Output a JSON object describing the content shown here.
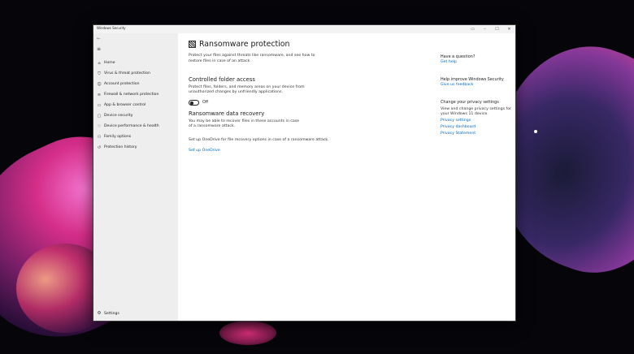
{
  "window": {
    "title": "Windows Security",
    "controls": {
      "restore": "▭",
      "minimize": "–",
      "maximize": "☐",
      "close": "✕"
    }
  },
  "sidebar": {
    "back": "←",
    "menu": "≡",
    "items": [
      {
        "label": "Home",
        "icon": "home-icon",
        "glyph": "⌂"
      },
      {
        "label": "Virus & threat protection",
        "icon": "shield-icon",
        "glyph": "⛉"
      },
      {
        "label": "Account protection",
        "icon": "person-icon",
        "glyph": "☺"
      },
      {
        "label": "Firewall & network protection",
        "icon": "wifi-icon",
        "glyph": "≋"
      },
      {
        "label": "App & browser control",
        "icon": "app-icon",
        "glyph": "▭"
      },
      {
        "label": "Device security",
        "icon": "laptop-icon",
        "glyph": "▢"
      },
      {
        "label": "Device performance & health",
        "icon": "heart-icon",
        "glyph": "♡"
      },
      {
        "label": "Family options",
        "icon": "family-icon",
        "glyph": "⚇"
      },
      {
        "label": "Protection history",
        "icon": "history-icon",
        "glyph": "↺"
      }
    ],
    "settings": {
      "label": "Settings",
      "glyph": "⚙"
    }
  },
  "main": {
    "title": "Ransomware protection",
    "intro": "Protect your files against threats like ransomware, and see how to restore files in case of an attack.",
    "cfa": {
      "title": "Controlled folder access",
      "desc": "Protect files, folders, and memory areas on your device from unauthorized changes by unfriendly applications.",
      "toggle_label": "Off"
    },
    "recovery": {
      "title": "Ransomware data recovery",
      "desc": "You may be able to recover files in these accounts in case of a ransomware attack.",
      "onedrive_text": "Set up OneDrive for file recovery options in case of a ransomware attack.",
      "onedrive_link": "Set up OneDrive"
    }
  },
  "right": {
    "question": {
      "title": "Have a question?",
      "link": "Get help"
    },
    "improve": {
      "title": "Help improve Windows Security",
      "link": "Give us feedback"
    },
    "privacy": {
      "title": "Change your privacy settings",
      "text": "View and change privacy settings for your Windows 11 device.",
      "links": [
        "Privacy settings",
        "Privacy dashboard",
        "Privacy Statement"
      ]
    }
  }
}
